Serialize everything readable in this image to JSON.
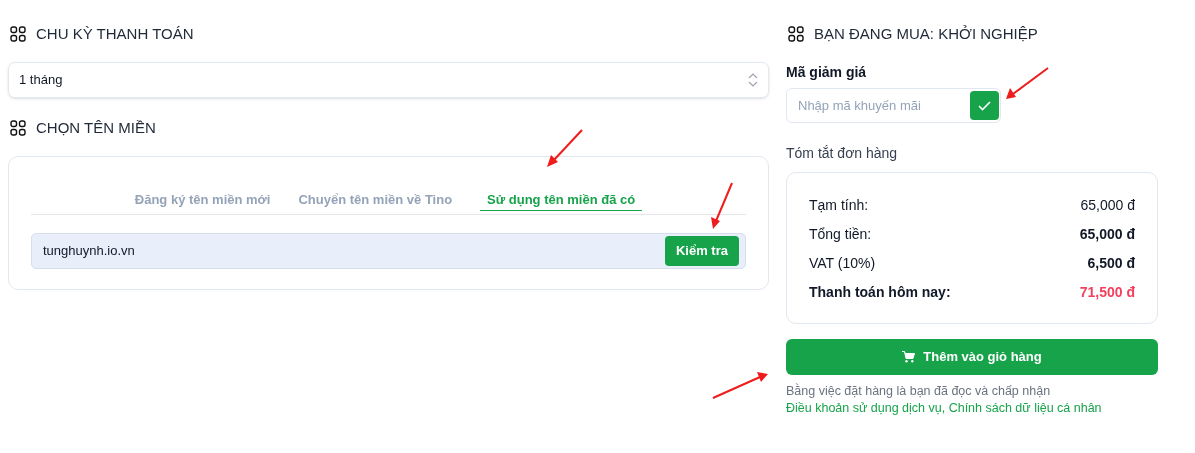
{
  "billing": {
    "heading": "CHU KỲ THANH TOÁN",
    "cycle": "1 tháng"
  },
  "domain": {
    "heading": "CHỌN TÊN MIỀN",
    "tabs": [
      {
        "label": "Đăng ký tên miền mới",
        "selected": false
      },
      {
        "label": "Chuyển tên miền về Tino",
        "selected": false
      },
      {
        "label": "Sử dụng tên miền đã có",
        "selected": true
      }
    ],
    "value": "tunghuynh.io.vn",
    "button": "Kiểm tra"
  },
  "order": {
    "heading": "BẠN ĐANG MUA: KHỞI NGHIỆP",
    "coupon_label": "Mã giảm giá",
    "coupon_placeholder": "Nhập mã khuyến mãi",
    "summary_title": "Tóm tắt đơn hàng",
    "rows": [
      {
        "kind": "plain",
        "label": "Tạm tính:",
        "value": "65,000 đ"
      },
      {
        "kind": "bold",
        "label": "Tổng tiền:",
        "value": "65,000 đ"
      },
      {
        "kind": "bold",
        "label": "VAT (10%)",
        "value": "6,500 đ"
      },
      {
        "kind": "total",
        "label": "Thanh toán hôm nay:",
        "value": "71,500 đ"
      }
    ],
    "cart_button": "Thêm vào giỏ hàng",
    "terms": {
      "text": "Bằng việc đặt hàng là bạn đã đọc và chấp nhận",
      "links": [
        "Điều khoản sử dụng dịch vụ,",
        "Chính sách dữ liệu cá nhân"
      ]
    }
  }
}
